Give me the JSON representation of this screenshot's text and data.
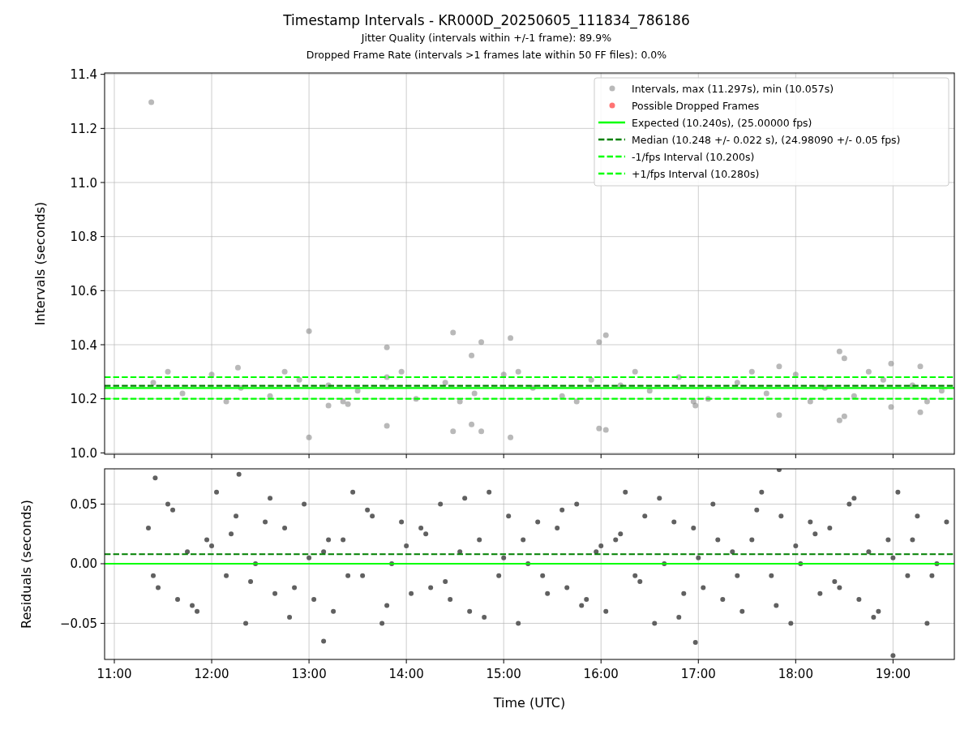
{
  "figure": {
    "title": "Timestamp Intervals - KR000D_20250605_111834_786186",
    "subtitles": [
      "Jitter Quality (intervals within +/-1 frame): 89.9%",
      "Dropped Frame Rate (intervals >1 frames late within 50 FF files): 0.0%"
    ]
  },
  "intervals_panel": {
    "chart_data": {
      "type": "scatter",
      "ylabel": "Intervals (seconds)",
      "xlim": [
        10.9,
        19.63
      ],
      "ylim": [
        9.995,
        11.405
      ],
      "yticks": [
        {
          "value": 10.0,
          "label": "10.0"
        },
        {
          "value": 10.2,
          "label": "10.2"
        },
        {
          "value": 10.4,
          "label": "10.4"
        },
        {
          "value": 10.6,
          "label": "10.6"
        },
        {
          "value": 10.8,
          "label": "10.8"
        },
        {
          "value": 11.0,
          "label": "11.0"
        },
        {
          "value": 11.2,
          "label": "11.2"
        },
        {
          "value": 11.4,
          "label": "11.4"
        }
      ],
      "series": [
        {
          "name": "Intervals, max (11.297s), min (10.057s)",
          "color": "#808080",
          "x": [
            11.38,
            13.0,
            13.0,
            13.8,
            13.8,
            14.48,
            14.48,
            14.67,
            14.67,
            14.77,
            14.77,
            15.07,
            15.07,
            15.98,
            16.05,
            15.98,
            16.05,
            16.97,
            17.83,
            17.83,
            18.45,
            18.5,
            18.45,
            18.5,
            18.98,
            18.98,
            19.28,
            19.28,
            12.27,
            13.2,
            13.4,
            11.4,
            11.7,
            12.0,
            12.3,
            12.6,
            12.9,
            13.2,
            13.5,
            13.8,
            14.1,
            14.4,
            14.7,
            15.0,
            15.3,
            15.6,
            15.9,
            16.2,
            16.5,
            16.8,
            17.1,
            17.4,
            17.7,
            18.0,
            18.3,
            18.6,
            18.9,
            19.2,
            19.5,
            11.55,
            12.15,
            12.75,
            13.35,
            13.95,
            14.55,
            15.15,
            15.75,
            16.35,
            16.95,
            17.55,
            18.15,
            18.75,
            19.35
          ],
          "values": [
            11.297,
            10.45,
            10.057,
            10.39,
            10.1,
            10.445,
            10.08,
            10.36,
            10.105,
            10.41,
            10.08,
            10.425,
            10.057,
            10.41,
            10.435,
            10.09,
            10.085,
            10.175,
            10.32,
            10.14,
            10.375,
            10.35,
            10.12,
            10.135,
            10.33,
            10.17,
            10.15,
            10.32,
            10.315,
            10.175,
            10.18,
            10.26,
            10.22,
            10.29,
            10.24,
            10.21,
            10.27,
            10.25,
            10.23,
            10.28,
            10.2,
            10.26,
            10.22,
            10.29,
            10.24,
            10.21,
            10.27,
            10.25,
            10.23,
            10.28,
            10.2,
            10.26,
            10.22,
            10.29,
            10.24,
            10.21,
            10.27,
            10.25,
            10.23,
            10.3,
            10.19,
            10.3,
            10.19,
            10.3,
            10.19,
            10.3,
            10.19,
            10.3,
            10.19,
            10.3,
            10.19,
            10.3,
            10.19
          ]
        },
        {
          "name": "Possible Dropped Frames",
          "color": "#ff0000"
        },
        {
          "name": "Expected (10.240s), (25.00000 fps)",
          "type": "line",
          "line_style": "solid",
          "color": "#00ff00",
          "x": [
            10.9,
            19.63
          ],
          "values": [
            10.24,
            10.24
          ]
        },
        {
          "name": "Median (10.248 +/- 0.022 s), (24.98090 +/- 0.05 fps)",
          "type": "line",
          "line_style": "dashed",
          "color": "#008000",
          "x": [
            10.9,
            19.63
          ],
          "values": [
            10.248,
            10.248
          ]
        },
        {
          "name": "-1/fps Interval (10.200s)",
          "type": "line",
          "line_style": "dashed",
          "color": "#00ff00",
          "x": [
            10.9,
            19.63
          ],
          "values": [
            10.2,
            10.2
          ]
        },
        {
          "name": "+1/fps Interval (10.280s)",
          "type": "line",
          "line_style": "dashed",
          "color": "#00ff00",
          "x": [
            10.9,
            19.63
          ],
          "values": [
            10.28,
            10.28
          ]
        }
      ],
      "grid": true,
      "legend": true
    }
  },
  "residuals_panel": {
    "chart_data": {
      "type": "scatter",
      "xlabel": "Time (UTC)",
      "ylabel": "Residuals (seconds)",
      "xlim": [
        10.9,
        19.63
      ],
      "ylim": [
        -0.0803,
        0.0796
      ],
      "xticks": [
        {
          "value": 11,
          "label": "11:00"
        },
        {
          "value": 12,
          "label": "12:00"
        },
        {
          "value": 13,
          "label": "13:00"
        },
        {
          "value": 14,
          "label": "14:00"
        },
        {
          "value": 15,
          "label": "15:00"
        },
        {
          "value": 16,
          "label": "16:00"
        },
        {
          "value": 17,
          "label": "17:00"
        },
        {
          "value": 18,
          "label": "18:00"
        },
        {
          "value": 19,
          "label": "19:00"
        }
      ],
      "yticks": [
        {
          "value": -0.05,
          "label": "−0.05"
        },
        {
          "value": 0,
          "label": "0.00"
        },
        {
          "value": 0.05,
          "label": "0.05"
        }
      ],
      "series": [
        {
          "color": "#606060",
          "x": [
            11.35,
            11.45,
            11.55,
            11.65,
            11.75,
            11.85,
            11.95,
            12.05,
            12.15,
            12.25,
            12.35,
            12.45,
            12.55,
            12.65,
            12.75,
            12.85,
            12.95,
            13.05,
            13.15,
            13.25,
            13.35,
            13.45,
            13.55,
            13.65,
            13.75,
            13.85,
            13.95,
            14.05,
            14.15,
            14.25,
            14.35,
            14.45,
            14.55,
            14.65,
            14.75,
            14.85,
            14.95,
            15.05,
            15.15,
            15.25,
            15.35,
            15.45,
            15.55,
            15.65,
            15.75,
            15.85,
            15.95,
            16.05,
            16.15,
            16.25,
            16.35,
            16.45,
            16.55,
            16.65,
            16.75,
            16.85,
            16.95,
            17.05,
            17.15,
            17.25,
            17.35,
            17.45,
            17.55,
            17.65,
            17.75,
            17.85,
            17.95,
            18.05,
            18.15,
            18.25,
            18.35,
            18.45,
            18.55,
            18.65,
            18.75,
            18.85,
            18.95,
            19.05,
            19.15,
            19.25,
            19.35,
            19.45,
            19.55,
            11.4,
            11.6,
            11.8,
            12.0,
            12.2,
            12.4,
            12.6,
            12.8,
            13.0,
            13.2,
            13.4,
            13.6,
            13.8,
            14.0,
            14.2,
            14.4,
            14.6,
            14.8,
            15.0,
            15.2,
            15.4,
            15.6,
            15.8,
            16.0,
            16.2,
            16.4,
            16.6,
            16.8,
            17.0,
            17.2,
            17.4,
            17.6,
            17.8,
            18.0,
            18.2,
            18.4,
            18.6,
            18.8,
            19.0,
            19.2,
            19.4,
            11.42,
            12.28,
            13.15,
            17.83,
            19.0,
            16.97
          ],
          "values": [
            0.03,
            -0.02,
            0.05,
            -0.03,
            0.01,
            -0.04,
            0.02,
            0.06,
            -0.01,
            0.04,
            -0.05,
            0,
            0.035,
            -0.025,
            0.03,
            -0.02,
            0.05,
            -0.03,
            0.01,
            -0.04,
            0.02,
            0.06,
            -0.01,
            0.04,
            -0.05,
            0,
            0.035,
            -0.025,
            0.03,
            -0.02,
            0.05,
            -0.03,
            0.01,
            -0.04,
            0.02,
            0.06,
            -0.01,
            0.04,
            -0.05,
            0,
            0.035,
            -0.025,
            0.03,
            -0.02,
            0.05,
            -0.03,
            0.01,
            -0.04,
            0.02,
            0.06,
            -0.01,
            0.04,
            -0.05,
            0,
            0.035,
            -0.025,
            0.03,
            -0.02,
            0.05,
            -0.03,
            0.01,
            -0.04,
            0.02,
            0.06,
            -0.01,
            0.04,
            -0.05,
            0,
            0.035,
            -0.025,
            0.03,
            -0.02,
            0.05,
            -0.03,
            0.01,
            -0.04,
            0.02,
            0.06,
            -0.01,
            0.04,
            -0.05,
            0,
            0.035,
            -0.01,
            0.045,
            -0.035,
            0.015,
            0.025,
            -0.015,
            0.055,
            -0.045,
            0.005,
            0.02,
            -0.01,
            0.045,
            -0.035,
            0.015,
            0.025,
            -0.015,
            0.055,
            -0.045,
            0.005,
            0.02,
            -0.01,
            0.045,
            -0.035,
            0.015,
            0.025,
            -0.015,
            0.055,
            -0.045,
            0.005,
            0.02,
            -0.01,
            0.045,
            -0.035,
            0.015,
            0.025,
            -0.015,
            0.055,
            -0.045,
            0.005,
            0.02,
            -0.01,
            0.072,
            0.075,
            -0.065,
            0.079,
            -0.077,
            -0.066
          ]
        },
        {
          "type": "line",
          "line_style": "solid",
          "color": "#00ff00",
          "x": [
            10.9,
            19.63
          ],
          "values": [
            0,
            0
          ]
        },
        {
          "type": "line",
          "line_style": "dashed",
          "color": "#008000",
          "x": [
            10.9,
            19.63
          ],
          "values": [
            0.008,
            0.008
          ]
        }
      ],
      "grid": true
    }
  }
}
